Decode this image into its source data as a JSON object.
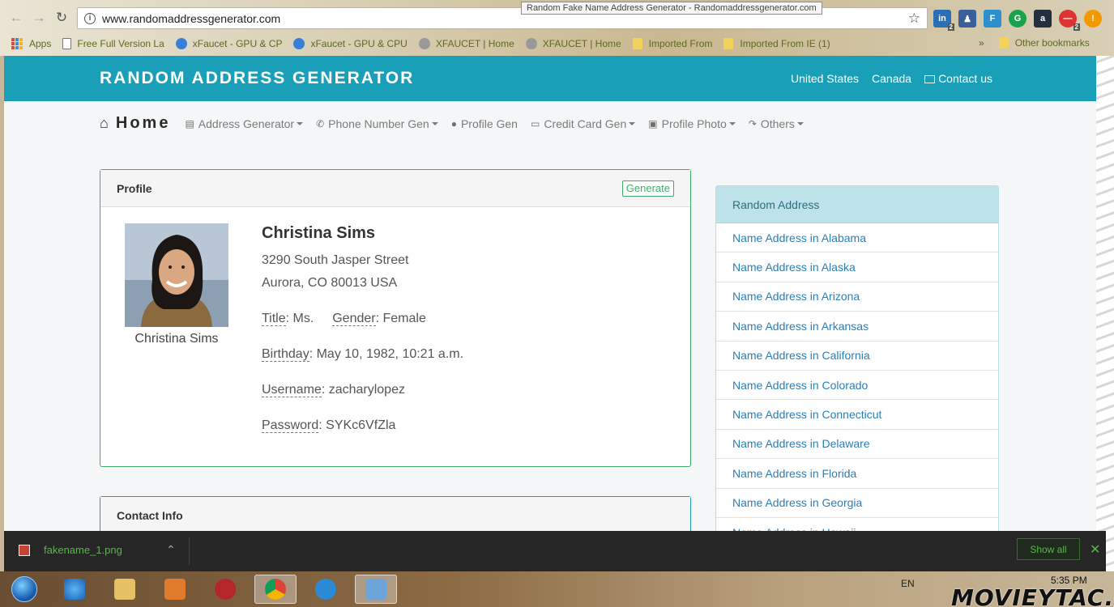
{
  "browser": {
    "url": "www.randomaddressgenerator.com",
    "tooltip": "Random Fake Name Address Generator - Randomaddressgenerator.com",
    "bookmarks": [
      {
        "label": "Apps",
        "icon": "apps-icon"
      },
      {
        "label": "Free Full Version La",
        "icon": "page-icon"
      },
      {
        "label": "xFaucet - GPU & CP",
        "icon": "bitcoin-icon"
      },
      {
        "label": "xFaucet - GPU & CPU",
        "icon": "bitcoin-icon"
      },
      {
        "label": "XFAUCET | Home",
        "icon": "litecoin-icon"
      },
      {
        "label": "XFAUCET | Home",
        "icon": "litecoin-icon"
      },
      {
        "label": "Imported From",
        "icon": "folder-icon"
      },
      {
        "label": "Imported From IE (1)",
        "icon": "folder-icon"
      }
    ],
    "overflow": "»",
    "other_bookmarks": "Other bookmarks",
    "ext_badges": [
      "2",
      "2"
    ]
  },
  "site": {
    "brand": "RANDOM ADDRESS GENERATOR",
    "header_nav": [
      "United States",
      "Canada",
      "Contact us"
    ],
    "home_label": "Home",
    "menu": [
      {
        "label": "Address Generator",
        "dropdown": true,
        "icon": "id-card-icon"
      },
      {
        "label": "Phone Number Gen",
        "dropdown": true,
        "icon": "phone-icon"
      },
      {
        "label": "Profile Gen",
        "dropdown": false,
        "icon": "user-icon"
      },
      {
        "label": "Credit Card Gen",
        "dropdown": true,
        "icon": "credit-card-icon"
      },
      {
        "label": "Profile Photo",
        "dropdown": true,
        "icon": "picture-icon"
      },
      {
        "label": "Others",
        "dropdown": true,
        "icon": "share-icon"
      }
    ]
  },
  "profile": {
    "card_title": "Profile",
    "generate_label": "Generate",
    "photo_caption": "Christina Sims",
    "name": "Christina Sims",
    "street": "3290 South Jasper Street",
    "city_line": "Aurora, CO 80013 USA",
    "title_label": "Title",
    "title_value": ": Ms.",
    "gender_label": "Gender",
    "gender_value": ": Female",
    "birthday_label": "Birthday",
    "birthday_value": ": May 10, 1982, 10:21 a.m.",
    "username_label": "Username",
    "username_value": ": zacharylopez",
    "password_label": "Password",
    "password_value": ": SYKc6VfZla"
  },
  "contact": {
    "card_title": "Contact Info"
  },
  "random_address": {
    "title": "Random Address",
    "items": [
      "Name Address in Alabama",
      "Name Address in Alaska",
      "Name Address in Arizona",
      "Name Address in Arkansas",
      "Name Address in California",
      "Name Address in Colorado",
      "Name Address in Connecticut",
      "Name Address in Delaware",
      "Name Address in Florida",
      "Name Address in Georgia",
      "Name Address in Hawaii"
    ]
  },
  "downloads": {
    "file": "fakename_1.png",
    "show_all": "Show all"
  },
  "taskbar": {
    "lang": "EN",
    "time": "5:35 PM"
  },
  "watermark": "MOVIEYTAC.CA",
  "colors": {
    "header": "#1a9fb8",
    "profile_border": "#3fae6a",
    "link": "#2a7fb8",
    "download_text": "#5ab54b"
  }
}
